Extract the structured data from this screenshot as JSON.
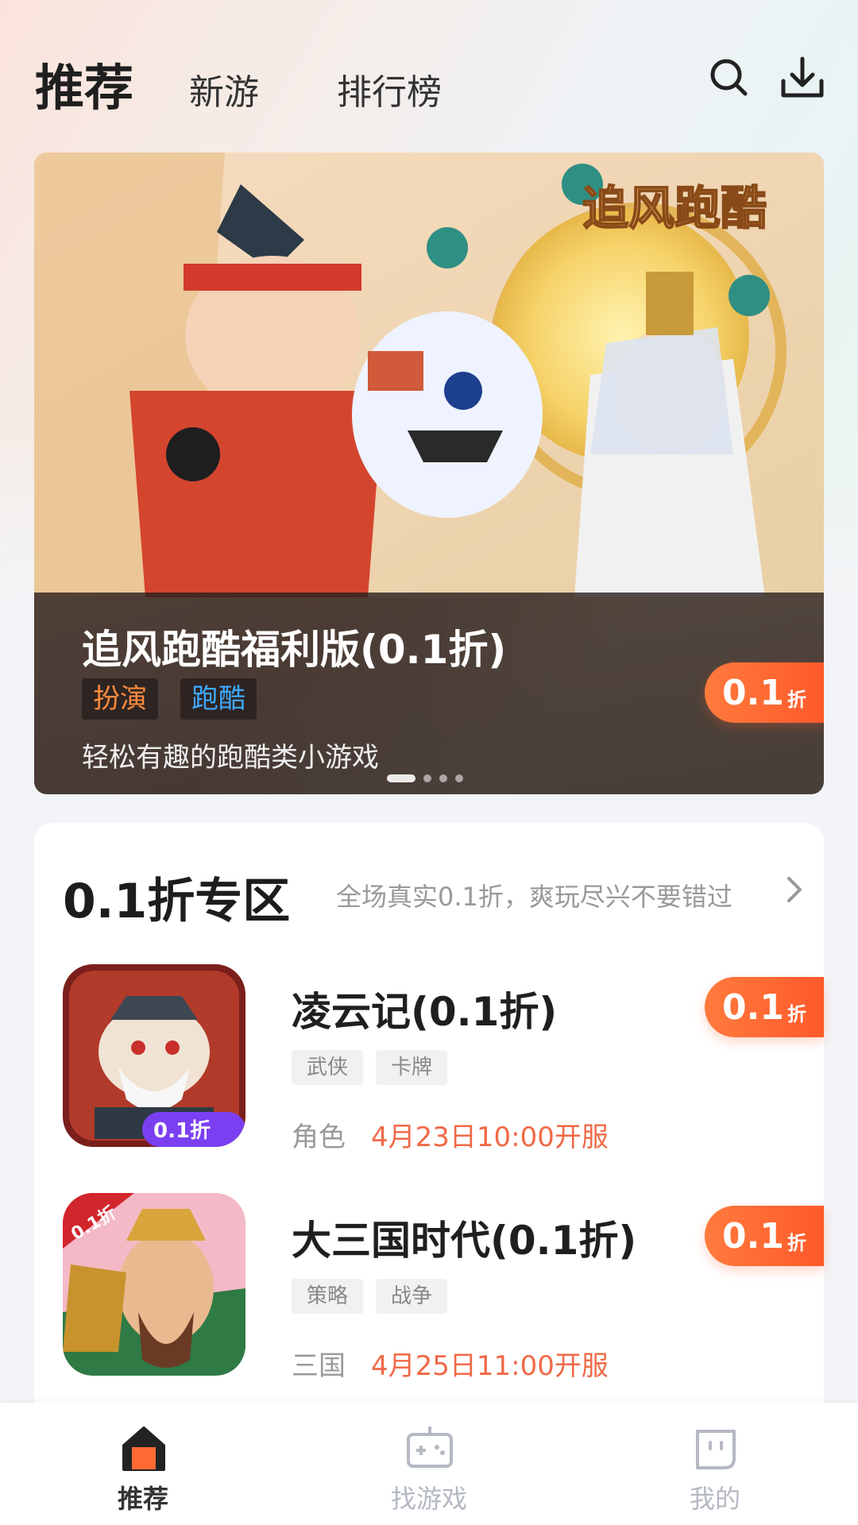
{
  "header": {
    "tabs": [
      {
        "label": "推荐",
        "active": true
      },
      {
        "label": "新游",
        "active": false
      },
      {
        "label": "排行榜",
        "active": false
      }
    ],
    "icons": [
      "search-icon",
      "download-icon"
    ]
  },
  "banner": {
    "title": "追风跑酷福利版(0.1折)",
    "tags": [
      "扮演",
      "跑酷"
    ],
    "description": "轻松有趣的跑酷类小游戏",
    "logo_text": "追风跑酷",
    "discount": {
      "value": "0.1",
      "unit": "折"
    },
    "slides_count": 4,
    "active_slide": 1
  },
  "section": {
    "title": "0.1折专区",
    "subtitle": "全场真实0.1折，爽玩尽兴不要错过",
    "games": [
      {
        "name": "凌云记(0.1折)",
        "tags": [
          "武侠",
          "卡牌"
        ],
        "category": "角色",
        "open_time": "4月23日10:00开服",
        "discount": {
          "value": "0.1",
          "unit": "折"
        },
        "icon_badge": "0.1折"
      },
      {
        "name": "大三国时代(0.1折)",
        "tags": [
          "策略",
          "战争"
        ],
        "category": "三国",
        "open_time": "4月25日11:00开服",
        "discount": {
          "value": "0.1",
          "unit": "折"
        },
        "icon_badge": "0.1折"
      }
    ]
  },
  "bottom_nav": {
    "items": [
      {
        "label": "推荐",
        "icon": "home-icon",
        "active": true
      },
      {
        "label": "找游戏",
        "icon": "gamepad-icon",
        "active": false
      },
      {
        "label": "我的",
        "icon": "profile-face-icon",
        "active": false
      }
    ]
  },
  "colors": {
    "accent_orange": "#ff6a33",
    "time_red": "#f06a47",
    "tag_blue": "#3fa9ff"
  }
}
